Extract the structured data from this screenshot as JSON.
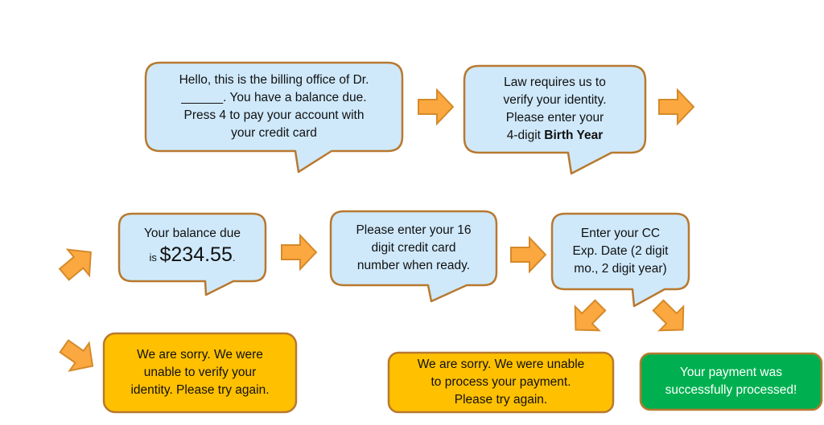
{
  "colors": {
    "bubble_fill": "#cfe9fb",
    "bubble_stroke": "#b8792f",
    "arrow_fill": "#fba840",
    "arrow_stroke": "#d58a2a",
    "error_fill": "#ffc000",
    "error_stroke": "#b8792f",
    "success_fill": "#00b050",
    "success_stroke": "#b8792f",
    "text": "#111111",
    "success_text": "#ffffff"
  },
  "bubbles": {
    "greeting": {
      "lines": [
        "Hello, this is the billing office of Dr.",
        "______. You have a balance due.",
        "Press 4 to pay your account with",
        "your credit card"
      ]
    },
    "verify_identity": {
      "lines": [
        "Law requires us to",
        "verify your identity.",
        "Please enter your"
      ],
      "last_line_prefix": "4-digit ",
      "last_line_bold": "Birth Year"
    },
    "balance": {
      "line1": "Your balance due",
      "prefix": "is ",
      "amount": "$234.55",
      "suffix": "."
    },
    "card_number": {
      "lines": [
        "Please enter your 16",
        "digit credit card",
        "number when ready."
      ]
    },
    "exp_date": {
      "lines": [
        "Enter your CC",
        "Exp. Date (2 digit",
        "mo., 2 digit year)"
      ]
    }
  },
  "outcomes": {
    "identity_error": {
      "lines": [
        "We are sorry.  We were",
        "unable to verify your",
        "identity. Please try again."
      ]
    },
    "payment_error": {
      "lines": [
        "We are sorry.  We were unable",
        "to process your payment.",
        "Please try again."
      ]
    },
    "payment_success": {
      "lines": [
        "Your payment was",
        "successfully processed!"
      ]
    }
  },
  "arrows": [
    {
      "name": "arrow-greeting-to-verify",
      "direction": "right"
    },
    {
      "name": "arrow-verify-to-next-row",
      "direction": "right"
    },
    {
      "name": "arrow-into-balance",
      "direction": "up-right"
    },
    {
      "name": "arrow-balance-to-card",
      "direction": "right"
    },
    {
      "name": "arrow-card-to-exp",
      "direction": "right"
    },
    {
      "name": "arrow-exp-to-error",
      "direction": "down-left"
    },
    {
      "name": "arrow-exp-to-success",
      "direction": "down-right"
    },
    {
      "name": "arrow-to-identity-error",
      "direction": "down-right"
    }
  ]
}
